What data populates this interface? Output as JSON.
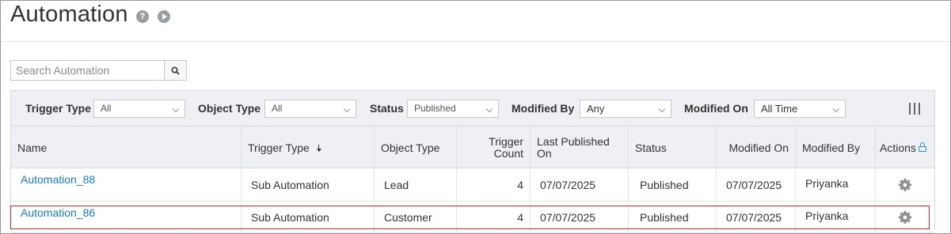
{
  "header": {
    "title": "Automation",
    "help_icon": "help-icon",
    "play_icon": "play-icon",
    "help_glyph": "?"
  },
  "search": {
    "placeholder": "Search Automation",
    "value": ""
  },
  "filters": [
    {
      "label": "Trigger Type",
      "value": "All"
    },
    {
      "label": "Object Type",
      "value": "All"
    },
    {
      "label": "Status",
      "value": "Published"
    },
    {
      "label": "Modified By",
      "value": "Any"
    },
    {
      "label": "Modified On",
      "value": "All Time"
    }
  ],
  "table": {
    "columns": [
      "Name",
      "Trigger Type",
      "Object Type",
      "Trigger Count",
      "Last Published On",
      "Status",
      "Modified On",
      "Modified By",
      "Actions"
    ],
    "rows": [
      {
        "name": "Automation_88",
        "trigger_type": "Sub Automation",
        "object_type": "Lead",
        "trigger_count": "4",
        "last_published_on": "07/07/2025",
        "status": "Published",
        "modified_on": "07/07/2025",
        "modified_by": "Priyanka"
      },
      {
        "name": "Automation_86",
        "trigger_type": "Sub Automation",
        "object_type": "Customer",
        "trigger_count": "4",
        "last_published_on": "07/07/2025",
        "status": "Published",
        "modified_on": "07/07/2025",
        "modified_by": "Priyanka"
      }
    ],
    "highlighted_row": "Automation_86"
  },
  "colors": {
    "link": "#1a7bc8",
    "header_bg": "#eef0f3",
    "highlight_border": "#d8282f",
    "lock": "#2a8fd4"
  }
}
